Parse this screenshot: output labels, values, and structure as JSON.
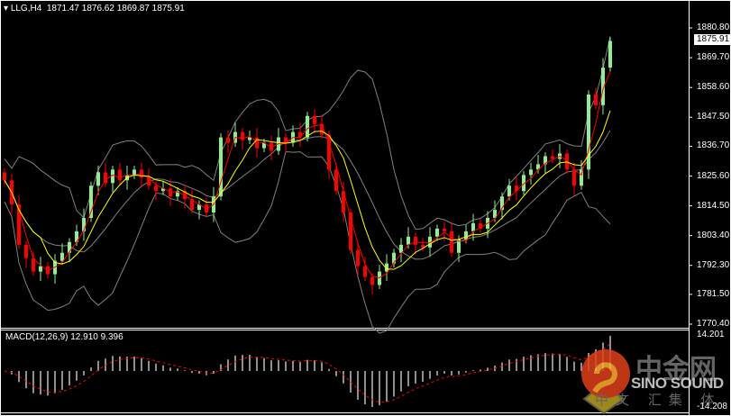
{
  "header": {
    "symbol": "LLG,H4",
    "open": "1871.47",
    "high": "1876.62",
    "low": "1869.87",
    "close": "1875.91"
  },
  "macd_label": {
    "name": "MACD(12,26,9)",
    "macd": "12.910",
    "signal": "9.396"
  },
  "colors": {
    "background": "#000000",
    "bull": "#90ee90",
    "bear": "#ff0000",
    "ma_fast": "#ff0000",
    "ma_slow": "#ffff00",
    "bands": "#808080",
    "histogram": "#c0c0c0",
    "signal": "#ff0000"
  },
  "watermark": {
    "cn": "中金网",
    "en": "SINO SOUND",
    "sub": "中文 汇集 体"
  },
  "chart_data": [
    {
      "type": "candlestick",
      "timeframe": "H4",
      "current_price": "1875.91",
      "ylim": [
        1766,
        1884
      ],
      "y_ticks": [
        "1880.80",
        "1869.70",
        "1858.60",
        "1847.50",
        "1836.70",
        "1825.60",
        "1814.50",
        "1803.40",
        "1792.30",
        "1781.50",
        "1770.40"
      ],
      "indicators": [
        "moving average (red)",
        "moving average (yellow)",
        "bollinger bands (gray)"
      ],
      "close": [
        1824,
        1815,
        1800,
        1795,
        1790,
        1792,
        1789,
        1794,
        1797,
        1801,
        1805,
        1810,
        1822,
        1827,
        1823,
        1828,
        1824,
        1826,
        1828,
        1825,
        1822,
        1820,
        1821,
        1818,
        1820,
        1817,
        1813,
        1815,
        1812,
        1818,
        1840,
        1838,
        1842,
        1839,
        1840,
        1836,
        1838,
        1835,
        1840,
        1838,
        1842,
        1840,
        1848,
        1845,
        1841,
        1828,
        1820,
        1812,
        1798,
        1792,
        1788,
        1785,
        1790,
        1793,
        1797,
        1800,
        1803,
        1800,
        1799,
        1803,
        1806,
        1805,
        1797,
        1802,
        1805,
        1808,
        1806,
        1810,
        1813,
        1818,
        1822,
        1820,
        1826,
        1828,
        1830,
        1833,
        1832,
        1834,
        1828,
        1822,
        1828,
        1856,
        1852,
        1866,
        1875.91
      ]
    },
    {
      "type": "bar",
      "name": "MACD(12,26,9)",
      "ylim": [
        -14.208,
        14.201
      ],
      "y_ticks": [
        "14.201",
        "-14.208"
      ],
      "series": [
        "histogram (gray)",
        "signal (red dotted)"
      ]
    }
  ]
}
